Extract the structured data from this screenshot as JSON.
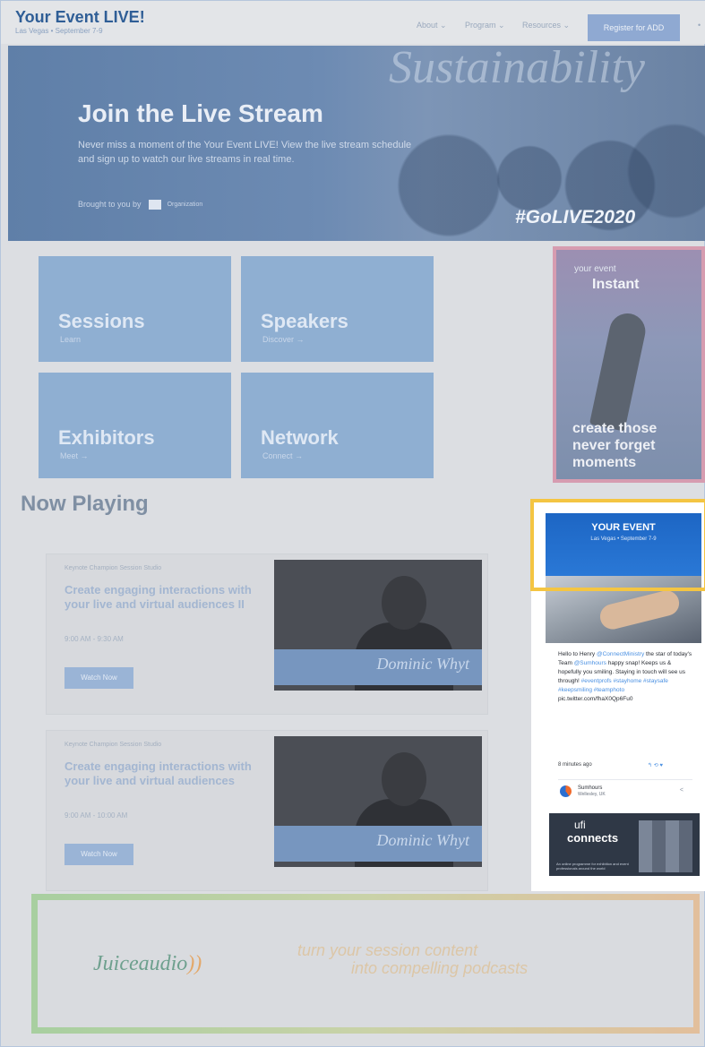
{
  "header": {
    "title": "Your Event LIVE!",
    "subtitle": "Las Vegas • September 7-9",
    "nav": [
      "About",
      "Program",
      "Resources"
    ],
    "cta": "Register for ADD",
    "more": "•"
  },
  "hero": {
    "bg_word": "Sustainability",
    "title": "Join the Live Stream",
    "description": "Never miss a moment of the Your Event LIVE! View the live stream schedule and sign up to watch our live streams in real time.",
    "sponsor_label": "Brought to you by",
    "sponsor_name": "Organization",
    "hashtag": "#GoLIVE2020"
  },
  "tiles": [
    {
      "name": "Sessions",
      "sub": "Learn"
    },
    {
      "name": "Speakers",
      "sub": "Discover →"
    },
    {
      "name": "Exhibitors",
      "sub": "Meet →"
    },
    {
      "name": "Network",
      "sub": "Connect →"
    }
  ],
  "ad_instant": {
    "top": "your event",
    "headline": "Instant",
    "tagline": "create those never forget moments"
  },
  "now_playing": {
    "title": "Now Playing",
    "sessions": [
      {
        "room": "Keynote Champion Session Studio",
        "title": "Create engaging interactions with your live and virtual audiences II",
        "time": "9:00 AM - 9:30 AM",
        "button": "Watch Now",
        "speaker": "Dominic Whyt"
      },
      {
        "room": "Keynote Champion Session Studio",
        "title": "Create engaging interactions with your live and virtual audiences",
        "time": "9:00 AM - 10:00 AM",
        "button": "Watch Now",
        "speaker": "Dominic Whyt"
      }
    ]
  },
  "twitter": {
    "banner_title": "YOUR EVENT",
    "banner_sub": "Las Vegas • September 7-9",
    "tweet_parts": [
      "Hello to Henry ",
      "@ConnectMinistry",
      " the star of today's Team ",
      "@Sumhours",
      " happy snap! Keeps us & hopefully you smiling. Staying in touch will see us through! ",
      "#eventprofs #stayhome #staysafe #keepsmiling #teamphoto",
      " pic.twitter.com/fhaX0Qp6Fu0"
    ],
    "time": "8 minutes ago",
    "actions": "↰ ⟲ ♥",
    "user_name": "Sumhours",
    "user_location": "Wellesley, UK",
    "share": "<",
    "ufi_brand": "ufi",
    "ufi_connects": "connects",
    "ufi_text": "An online programme for exhibition and event professionals around the world"
  },
  "juice": {
    "logo": "Juiceaudio",
    "logo_mark": "))",
    "line1": "turn your session content",
    "line2": "into compelling podcasts"
  }
}
